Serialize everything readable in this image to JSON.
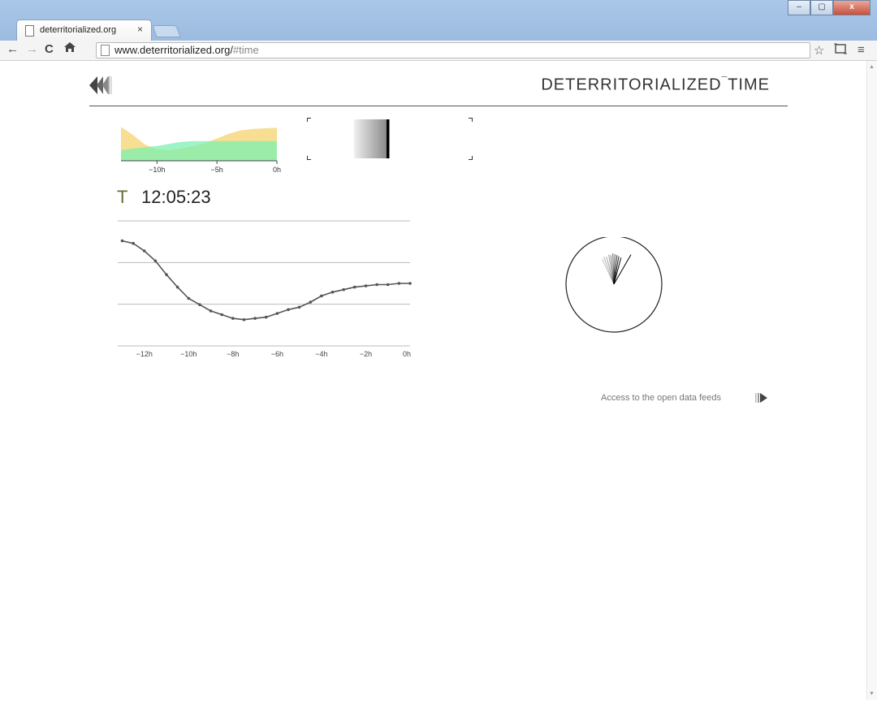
{
  "browser": {
    "tab_title": "deterritorialized.org",
    "tab_close": "×",
    "url_host": "www.deterritorialized.org/",
    "url_path": "#time",
    "window_minimize": "–",
    "window_maximize": "▢",
    "window_close": "x"
  },
  "nav_icons": {
    "back": "left-arrow-icon",
    "forward": "right-arrow-icon",
    "reload": "reload-icon",
    "home": "home-icon",
    "star": "star-icon",
    "cast": "cast-icon",
    "menu": "menu-icon"
  },
  "header": {
    "title_main": "DETERRITORIALIZED",
    "title_sup": "¯",
    "title_end": "TIME"
  },
  "clock": {
    "label": "T",
    "time": "12:05:23"
  },
  "footer_link": {
    "label": "Access to the open data feeds"
  },
  "colors": {
    "area_yellow": "#f5d36f",
    "area_green": "#7ef0b0",
    "line": "#555555",
    "title_rule": "#555555"
  },
  "chart_data": [
    {
      "type": "area",
      "x_ticks": [
        "−10h",
        "−5h",
        "0h"
      ],
      "x": [
        -13,
        -12,
        -11,
        -10,
        -9,
        -8,
        -7,
        -6,
        -5,
        -4,
        -3,
        -2,
        -1,
        0
      ],
      "series": [
        {
          "values": [
            5.0,
            3.8,
            2.4,
            1.7,
            1.6,
            1.8,
            2.2,
            2.6,
            3.3,
            4.0,
            4.5,
            4.7,
            4.8,
            4.9
          ]
        },
        {
          "values": [
            1.6,
            1.8,
            2.0,
            2.2,
            2.5,
            2.8,
            2.9,
            2.9,
            2.9,
            2.9,
            2.9,
            2.9,
            2.9,
            2.9
          ]
        }
      ]
    },
    {
      "type": "line",
      "x_ticks": [
        "−12h",
        "−10h",
        "−8h",
        "−6h",
        "−4h",
        "−2h",
        "0h"
      ],
      "xlim": [
        -13.2,
        0
      ],
      "ylim": [
        0,
        100
      ],
      "x": [
        -13,
        -12.5,
        -12,
        -11.5,
        -11,
        -10.5,
        -10,
        -9.5,
        -9,
        -8.5,
        -8,
        -7.5,
        -7,
        -6.5,
        -6,
        -5.5,
        -5,
        -4.5,
        -4,
        -3.5,
        -3,
        -2.5,
        -2,
        -1.5,
        -1,
        -0.5,
        0
      ],
      "y": [
        84,
        82,
        76,
        68,
        57,
        47,
        38,
        33,
        28,
        25,
        22,
        21,
        22,
        23,
        26,
        29,
        31,
        35,
        40,
        43,
        45,
        47,
        48,
        49,
        49,
        50,
        50
      ]
    }
  ]
}
